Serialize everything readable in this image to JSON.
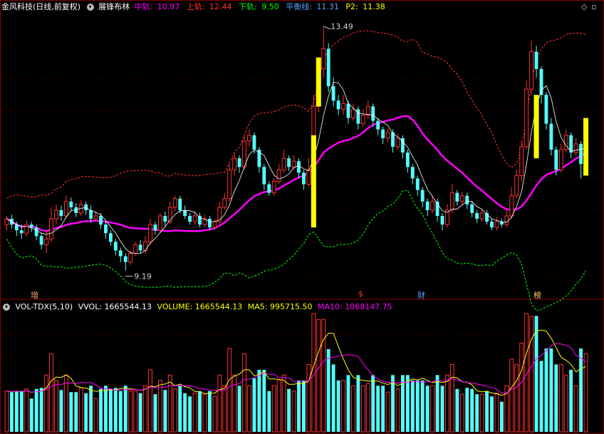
{
  "header": {
    "stock": "金风科技(日线,前复权)",
    "indicator": "展锋布林",
    "mid_label": "中轨: ",
    "mid_value": "10.97",
    "upper_label": "上轨: ",
    "upper_value": "12.44",
    "lower_label": "下轨: ",
    "lower_value": "9.50",
    "balance_label": "平衡线: ",
    "balance_value": "11.31",
    "p2_label": "P2: ",
    "p2_value": "11.38"
  },
  "annotations": {
    "high": "13.49",
    "low": "9.19"
  },
  "events": [
    "增",
    "$",
    "财",
    "榜"
  ],
  "volume_header": {
    "name": "VOL-TDX(5,10)",
    "vvol": "VVOL: 1665544.13",
    "volume": "VOLUME: 1665544.13",
    "ma5": "MA5: 995715.50",
    "ma10": "MA10: 1068147.75"
  },
  "colors": {
    "up": "#ff3232",
    "down": "#54fcfc",
    "ma": "#ff00ff",
    "yellow": "#ffff00",
    "upper": "#ff3232",
    "lower": "#00ff00"
  },
  "chart_data": {
    "type": "candlestick",
    "price_range": [
      9.0,
      13.7
    ],
    "candles": [
      [
        10.05,
        10.15,
        10.2,
        9.95
      ],
      [
        10.15,
        10.05,
        10.22,
        9.98
      ],
      [
        10.05,
        9.95,
        10.1,
        9.85
      ],
      [
        9.95,
        9.9,
        10.05,
        9.8
      ],
      [
        9.9,
        10.05,
        10.12,
        9.85
      ],
      [
        10.05,
        10.0,
        10.1,
        9.92
      ],
      [
        10.0,
        9.85,
        10.05,
        9.78
      ],
      [
        9.85,
        9.7,
        9.9,
        9.62
      ],
      [
        9.7,
        9.8,
        9.95,
        9.55
      ],
      [
        9.8,
        10.15,
        10.35,
        9.75
      ],
      [
        10.15,
        10.3,
        10.4,
        10.05
      ],
      [
        10.3,
        10.2,
        10.38,
        10.12
      ],
      [
        10.2,
        10.45,
        10.55,
        10.15
      ],
      [
        10.45,
        10.35,
        10.52,
        10.28
      ],
      [
        10.35,
        10.25,
        10.42,
        10.18
      ],
      [
        10.25,
        10.4,
        10.48,
        10.2
      ],
      [
        10.4,
        10.3,
        10.45,
        10.22
      ],
      [
        10.3,
        10.15,
        10.38,
        10.08
      ],
      [
        10.15,
        10.2,
        10.28,
        10.1
      ],
      [
        10.2,
        10.05,
        10.25,
        9.98
      ],
      [
        10.05,
        9.9,
        10.1,
        9.8
      ],
      [
        9.9,
        9.75,
        9.95,
        9.68
      ],
      [
        9.75,
        9.6,
        9.8,
        9.52
      ],
      [
        9.6,
        9.5,
        9.65,
        9.4
      ],
      [
        9.5,
        9.4,
        9.55,
        9.25
      ],
      [
        9.4,
        9.55,
        9.6,
        9.35
      ],
      [
        9.55,
        9.7,
        9.75,
        9.5
      ],
      [
        9.7,
        9.6,
        9.78,
        9.55
      ],
      [
        9.6,
        9.75,
        9.85,
        9.55
      ],
      [
        9.75,
        10.05,
        10.15,
        9.7
      ],
      [
        10.05,
        9.95,
        10.1,
        9.88
      ],
      [
        9.95,
        10.2,
        10.25,
        9.9
      ],
      [
        10.2,
        10.1,
        10.28,
        10.02
      ],
      [
        10.1,
        10.35,
        10.45,
        10.05
      ],
      [
        10.35,
        10.5,
        10.55,
        10.28
      ],
      [
        10.5,
        10.3,
        10.55,
        10.25
      ],
      [
        10.3,
        10.2,
        10.38,
        10.15
      ],
      [
        10.2,
        10.1,
        10.25,
        10.05
      ],
      [
        10.1,
        10.2,
        10.28,
        10.05
      ],
      [
        10.2,
        10.05,
        10.25,
        10.0
      ],
      [
        10.05,
        10.15,
        10.22,
        10.0
      ],
      [
        10.15,
        10.0,
        10.2,
        9.95
      ],
      [
        10.0,
        10.1,
        10.15,
        9.95
      ],
      [
        10.1,
        10.35,
        10.45,
        10.05
      ],
      [
        10.35,
        10.5,
        10.6,
        10.3
      ],
      [
        10.5,
        11.0,
        11.1,
        10.45
      ],
      [
        11.0,
        11.2,
        11.3,
        10.9
      ],
      [
        11.2,
        11.05,
        11.25,
        10.95
      ],
      [
        11.05,
        11.5,
        11.6,
        11.0
      ],
      [
        11.5,
        11.6,
        11.7,
        11.4
      ],
      [
        11.6,
        11.35,
        11.65,
        11.28
      ],
      [
        11.35,
        11.05,
        11.4,
        10.95
      ],
      [
        11.05,
        10.75,
        11.1,
        10.65
      ],
      [
        10.75,
        10.6,
        10.8,
        10.55
      ],
      [
        10.6,
        10.8,
        10.85,
        10.55
      ],
      [
        10.8,
        11.0,
        11.1,
        10.75
      ],
      [
        11.0,
        11.2,
        11.35,
        10.95
      ],
      [
        11.2,
        11.05,
        11.25,
        10.98
      ],
      [
        11.05,
        11.15,
        11.25,
        11.0
      ],
      [
        11.15,
        10.95,
        11.2,
        10.85
      ],
      [
        10.95,
        10.75,
        11.0,
        10.65
      ],
      [
        10.75,
        11.0,
        11.2,
        10.7
      ],
      [
        11.0,
        12.1,
        12.3,
        10.95
      ],
      [
        12.1,
        12.75,
        12.9,
        12.0
      ],
      [
        12.75,
        13.1,
        13.49,
        12.6
      ],
      [
        13.1,
        12.45,
        13.2,
        12.35
      ],
      [
        12.45,
        12.2,
        12.6,
        12.1
      ],
      [
        12.2,
        12.05,
        12.3,
        11.95
      ],
      [
        12.05,
        12.15,
        12.3,
        11.95
      ],
      [
        12.15,
        11.9,
        12.2,
        11.8
      ],
      [
        11.9,
        12.05,
        12.15,
        11.85
      ],
      [
        12.05,
        11.8,
        12.1,
        11.7
      ],
      [
        11.8,
        11.95,
        12.05,
        11.75
      ],
      [
        11.95,
        12.1,
        12.2,
        11.88
      ],
      [
        12.1,
        11.85,
        12.15,
        11.75
      ],
      [
        11.85,
        11.7,
        11.9,
        11.6
      ],
      [
        11.7,
        11.55,
        11.75,
        11.45
      ],
      [
        11.55,
        11.65,
        11.72,
        11.48
      ],
      [
        11.65,
        11.4,
        11.7,
        11.3
      ],
      [
        11.4,
        11.55,
        11.62,
        11.35
      ],
      [
        11.55,
        11.3,
        11.6,
        11.2
      ],
      [
        11.3,
        11.05,
        11.35,
        10.95
      ],
      [
        11.05,
        10.85,
        11.1,
        10.75
      ],
      [
        10.85,
        10.65,
        10.9,
        10.55
      ],
      [
        10.65,
        10.45,
        10.7,
        10.35
      ],
      [
        10.45,
        10.3,
        10.5,
        10.2
      ],
      [
        10.3,
        10.45,
        10.55,
        10.25
      ],
      [
        10.45,
        10.2,
        10.5,
        10.1
      ],
      [
        10.2,
        10.05,
        10.25,
        9.95
      ],
      [
        10.05,
        10.3,
        10.4,
        10.0
      ],
      [
        10.3,
        10.6,
        10.75,
        10.25
      ],
      [
        10.6,
        10.45,
        10.65,
        10.38
      ],
      [
        10.45,
        10.55,
        10.62,
        10.4
      ],
      [
        10.55,
        10.4,
        10.6,
        10.32
      ],
      [
        10.4,
        10.25,
        10.45,
        10.18
      ],
      [
        10.25,
        10.15,
        10.3,
        10.08
      ],
      [
        10.15,
        10.25,
        10.32,
        10.1
      ],
      [
        10.25,
        10.1,
        10.3,
        10.05
      ],
      [
        10.1,
        10.0,
        10.15,
        9.95
      ],
      [
        10.0,
        10.1,
        10.18,
        9.95
      ],
      [
        10.1,
        10.05,
        10.15,
        10.0
      ],
      [
        10.05,
        10.2,
        10.3,
        10.0
      ],
      [
        10.2,
        10.55,
        10.7,
        10.15
      ],
      [
        10.55,
        10.9,
        11.0,
        10.5
      ],
      [
        10.9,
        11.4,
        11.5,
        10.8
      ],
      [
        11.4,
        12.4,
        12.55,
        11.35
      ],
      [
        12.4,
        13.05,
        13.25,
        12.3
      ],
      [
        13.05,
        12.75,
        13.15,
        12.6
      ],
      [
        12.75,
        12.3,
        12.8,
        12.15
      ],
      [
        12.3,
        11.8,
        12.35,
        11.7
      ],
      [
        11.8,
        11.35,
        11.9,
        11.25
      ],
      [
        11.35,
        11.0,
        11.4,
        10.9
      ],
      [
        11.0,
        11.35,
        11.45,
        10.95
      ],
      [
        11.35,
        11.6,
        11.7,
        11.3
      ],
      [
        11.6,
        11.3,
        11.65,
        11.2
      ],
      [
        11.3,
        11.45,
        11.55,
        11.25
      ],
      [
        11.45,
        11.1,
        11.5,
        10.85
      ],
      [
        11.1,
        11.38,
        11.5,
        10.9
      ]
    ]
  }
}
